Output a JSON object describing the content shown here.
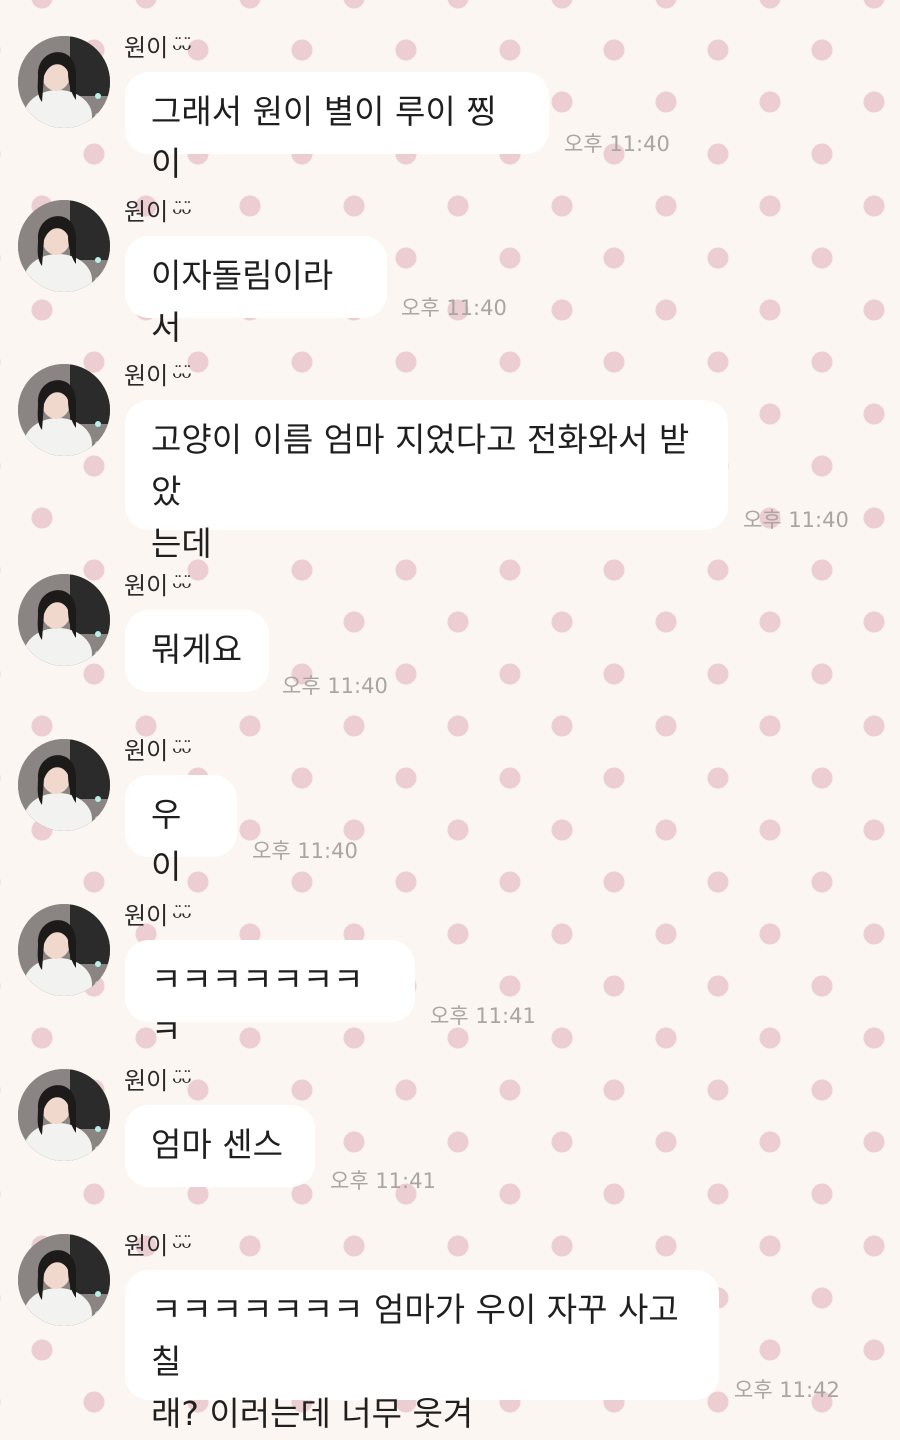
{
  "sender": {
    "name": "원이",
    "emoji": "ᴗ̈ᴗ̈",
    "avatar_icon": "profile-photo"
  },
  "messages": [
    {
      "lines": [
        "그래서 원이 별이 루이 찡이"
      ],
      "time": "오후 11:40"
    },
    {
      "lines": [
        "이자돌림이라서"
      ],
      "time": "오후 11:40"
    },
    {
      "lines": [
        "고양이 이름 엄마 지었다고 전화와서 받았",
        "는데"
      ],
      "time": "오후 11:40"
    },
    {
      "lines": [
        "뭐게요"
      ],
      "time": "오후 11:40"
    },
    {
      "lines": [
        "우이"
      ],
      "time": "오후 11:40"
    },
    {
      "lines": [
        "ㅋㅋㅋㅋㅋㅋㅋㅋ"
      ],
      "time": "오후 11:41"
    },
    {
      "lines": [
        "엄마 센스"
      ],
      "time": "오후 11:41"
    },
    {
      "lines": [
        "ㅋㅋㅋㅋㅋㅋㅋ 엄마가 우이 자꾸 사고칠",
        "래? 이러는데 너무 웃겨"
      ],
      "time": "오후 11:42"
    }
  ],
  "colors": {
    "background": "#fcf6f2",
    "dots": "#ebcdd2",
    "bubble": "#ffffff",
    "text": "#1f1f1f",
    "time": "#a9a5a3"
  }
}
